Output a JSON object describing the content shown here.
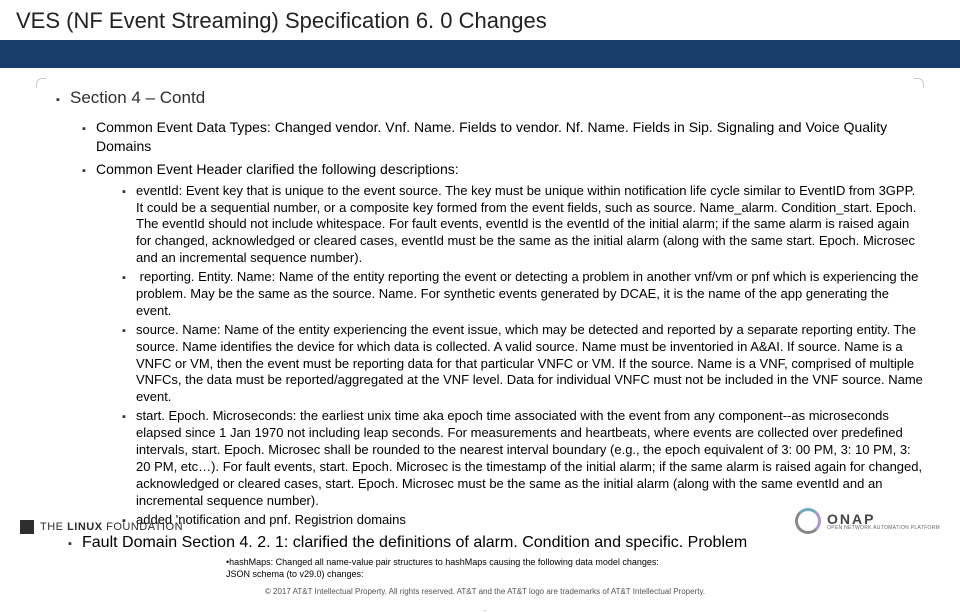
{
  "title": "VES (NF Event Streaming) Specification 6. 0  Changes",
  "section_heading": "Section 4 – Contd",
  "l1_items": [
    "Common Event Data Types: Changed vendor. Vnf. Name. Fields to vendor. Nf. Name. Fields in  Sip. Signaling and Voice Quality Domains",
    "Common Event Header clarified the following descriptions:"
  ],
  "l2_items": [
    "eventId: Event key that is unique to the event source. The key must be unique within notification life cycle similar to EventID from 3GPP. It could be a sequential number, or a composite key formed from the event fields, such as source. Name_alarm. Condition_start. Epoch.  The eventId should not include whitespace.  For fault events, eventId is the eventId of the initial alarm; if the same alarm is raised again for changed, acknowledged or cleared cases, eventId must be the same as the initial alarm (along with the same start. Epoch. Microsec and an incremental sequence number).",
    " reporting. Entity. Name: Name of the entity reporting the event or detecting a problem in another vnf/vm or pnf which is experiencing the problem. May be the same as the source. Name. For synthetic events generated by DCAE, it is the name of the app generating the event.",
    "source. Name: Name of the entity experiencing the event issue, which may be detected and reported by a separate reporting entity. The source. Name identifies the device for which data is collected. A valid source. Name must be inventoried in A&AI. If source. Name is a VNFC or VM, then the event must be reporting data for that particular VNFC or VM. If the source. Name is a VNF, comprised of multiple VNFCs, the data must be reported/aggregated at the VNF level. Data for individual VNFC must not be included in the VNF source. Name event.",
    "start. Epoch. Microseconds:  the earliest unix time aka epoch time associated with the event from any component--as microseconds elapsed since 1 Jan 1970 not including leap seconds. For measurements and heartbeats, where events are collected over predefined intervals, start. Epoch. Microsec shall be rounded to the nearest interval boundary (e.g., the epoch equivalent of 3: 00 PM, 3: 10 PM, 3: 20 PM, etc…). For fault events, start. Epoch. Microsec is the timestamp of the initial alarm; if the same alarm is raised again for changed, acknowledged or cleared cases, start. Epoch. Microsec must be the same as the initial alarm (along with the same eventId and an incremental sequence number).",
    "added 'notification and pnf. Registrion domains"
  ],
  "l0_item": "Fault Domain Section 4. 2. 1: clarified the definitions of alarm. Condition and specific. Problem",
  "small_notes": [
    "hashMaps: Changed all name-value pair structures to hashMaps causing the following data model changes:",
    "JSON schema (to v29.0) changes:"
  ],
  "copyright": "© 2017 AT&T Intellectual Property. All rights reserved. AT&T and the AT&T logo are trademarks of AT&T Intellectual Property.",
  "dot": ".",
  "logos": {
    "linux_the": "THE",
    "linux_name": "LINUX",
    "linux_found": "FOUNDATION",
    "onap_name": "ONAP",
    "onap_sub": "OPEN NETWORK AUTOMATION PLATFORM"
  }
}
